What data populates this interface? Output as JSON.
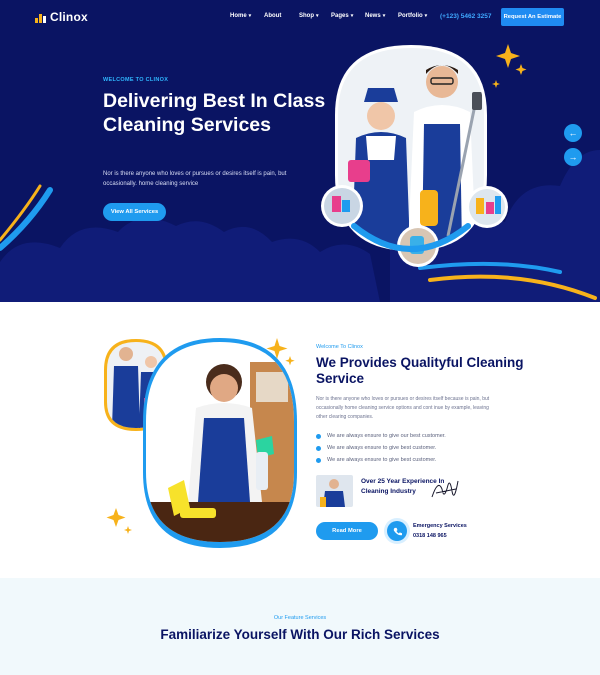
{
  "brand": {
    "name": "Clinox"
  },
  "nav": {
    "items": [
      {
        "label": "Home",
        "dropdown": true
      },
      {
        "label": "About",
        "dropdown": false
      },
      {
        "label": "Shop",
        "dropdown": true
      },
      {
        "label": "Pages",
        "dropdown": true
      },
      {
        "label": "News",
        "dropdown": true
      },
      {
        "label": "Portfolio",
        "dropdown": true
      }
    ],
    "phone": "(+123) 5462 3257",
    "cta": "Request An Estimate"
  },
  "hero": {
    "eyebrow": "WELCOME TO CLINOX",
    "title": "Delivering Best In Class Cleaning Services",
    "description": "Nor is there anyone who loves or pursues or desires itself is pain, but occasionally. home cleaning service",
    "button": "View All Services",
    "prev_arrow": "←",
    "next_arrow": "→"
  },
  "about": {
    "eyebrow": "Welcome To Clinox",
    "title": "We Provides Qualityful Cleaning Service",
    "description": "Nor is there anyone who loves or pursues or desires itself because is pain, but occasionally home cleaning service options and cont inue by example, leaving other clearing companies.",
    "checklist": [
      "We are always ensure to give our best customer.",
      "We are always ensure to give best customer.",
      "We are always ensure to give best customer."
    ],
    "experience": "Over 25 Year Experience In Cleaning Industry",
    "button": "Read More",
    "emergency_label": "Emergency Services",
    "emergency_number": "0318 148 965"
  },
  "services": {
    "eyebrow": "Our Feature Services",
    "title": "Familiarize Yourself With Our Rich Services"
  },
  "colors": {
    "navy": "#0a1463",
    "accent_blue": "#1f9bef",
    "accent_yellow": "#f7b21b"
  }
}
